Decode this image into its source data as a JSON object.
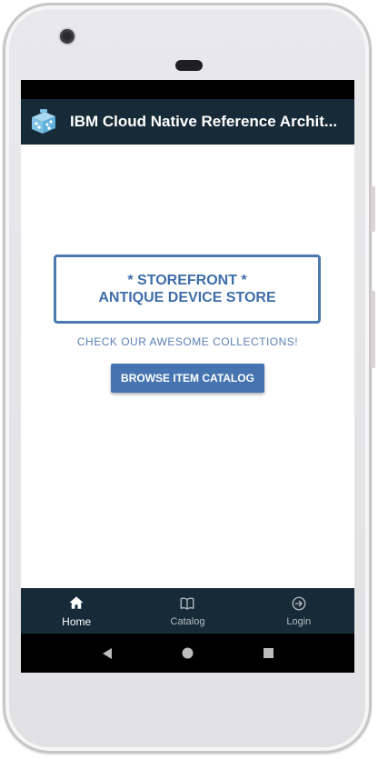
{
  "app": {
    "title": "IBM Cloud Native Reference Archit..."
  },
  "hero": {
    "line1": "* STOREFRONT *",
    "line2": "ANTIQUE DEVICE STORE",
    "tagline": "CHECK OUR AWESOME COLLECTIONS!",
    "browse_button": "BROWSE ITEM CATALOG"
  },
  "bottom_nav": {
    "items": [
      {
        "label": "Home",
        "icon": "home-icon",
        "active": true
      },
      {
        "label": "Catalog",
        "icon": "book-icon",
        "active": false
      },
      {
        "label": "Login",
        "icon": "login-icon",
        "active": false
      }
    ]
  },
  "colors": {
    "appbar": "#172a37",
    "accent": "#4574b0",
    "text_accent": "#3f6ea8"
  }
}
